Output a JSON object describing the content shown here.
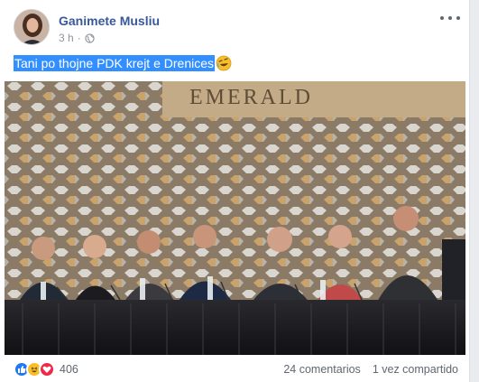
{
  "post": {
    "author": "Ganimete Musliu",
    "time": "3 h",
    "separator": "·",
    "text": "Tani po thojne PDK krejt e Drenices",
    "text_emoji": "rolling-on-floor-laughing-emoji",
    "photo_sign": "EMERALD"
  },
  "footer": {
    "reaction_count": "406",
    "comments": "24 comentarios",
    "shares": "1 vez compartido"
  },
  "colors": {
    "author": "#385898",
    "selection": "#338fff",
    "like": "#2078f4",
    "haha": "#f7c02a",
    "love": "#f0284a"
  }
}
